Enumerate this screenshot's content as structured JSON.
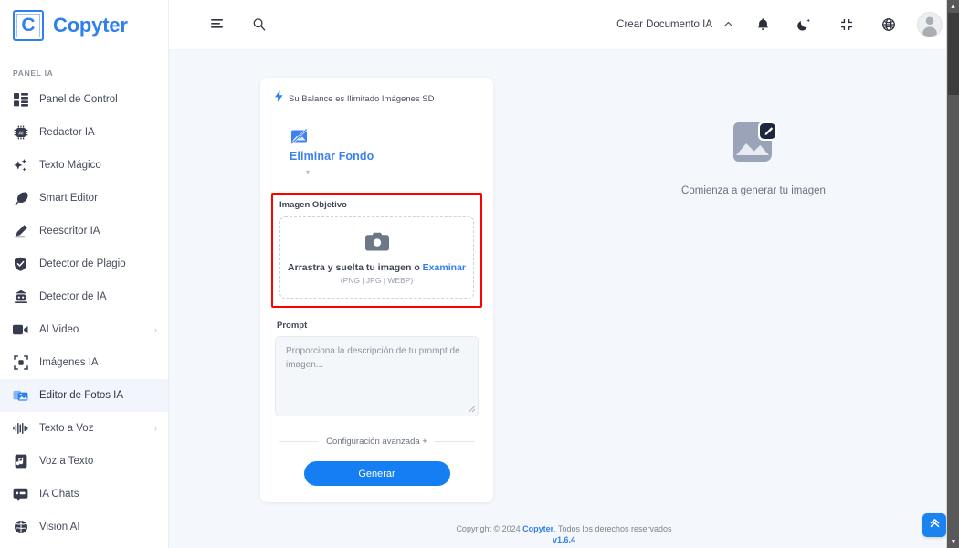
{
  "brand": {
    "mark": "C",
    "name": "Copyter"
  },
  "sidebar": {
    "section_label": "PANEL IA",
    "items": [
      {
        "label": "Panel de Control",
        "icon": "dashboard-icon",
        "active": false,
        "chevron": ""
      },
      {
        "label": "Redactor IA",
        "icon": "chip-ai-icon",
        "active": false,
        "chevron": ""
      },
      {
        "label": "Texto Mágico",
        "icon": "sparkles-icon",
        "active": false,
        "chevron": ""
      },
      {
        "label": "Smart Editor",
        "icon": "feather-icon",
        "active": false,
        "chevron": ""
      },
      {
        "label": "Reescritor IA",
        "icon": "pencil-icon",
        "active": false,
        "chevron": ""
      },
      {
        "label": "Detector de Plagio",
        "icon": "shield-check-icon",
        "active": false,
        "chevron": ""
      },
      {
        "label": "Detector de IA",
        "icon": "robot-icon",
        "active": false,
        "chevron": ""
      },
      {
        "label": "AI Video",
        "icon": "video-camera-icon",
        "active": false,
        "chevron": "›"
      },
      {
        "label": "Imágenes IA",
        "icon": "image-frame-icon",
        "active": false,
        "chevron": ""
      },
      {
        "label": "Editor de Fotos IA",
        "icon": "photo-edit-icon",
        "active": true,
        "chevron": ""
      },
      {
        "label": "Texto a Voz",
        "icon": "waveform-icon",
        "active": false,
        "chevron": "›"
      },
      {
        "label": "Voz a Texto",
        "icon": "audio-file-icon",
        "active": false,
        "chevron": ""
      },
      {
        "label": "IA Chats",
        "icon": "chat-icon",
        "active": false,
        "chevron": ""
      },
      {
        "label": "Vision AI",
        "icon": "brain-icon",
        "active": false,
        "chevron": ""
      }
    ]
  },
  "topbar": {
    "menu_icon": "menu-icon",
    "search_icon": "search-icon",
    "create_document_label": "Crear Documento IA",
    "create_caret": "⌃",
    "notifications_icon": "bell-icon",
    "theme_icon": "moon-icon",
    "fullscreen_icon": "compress-icon",
    "language_icon": "globe-icon",
    "avatar_icon": "user-avatar"
  },
  "card": {
    "balance_icon": "bolt-icon",
    "balance_text": "Su Balance es Ilimitado Imágenes SD",
    "tool": {
      "icon": "remove-background-icon",
      "name": "Eliminar Fondo",
      "caret": "▾"
    },
    "target_image": {
      "label": "Imagen Objetivo",
      "dropzone_icon": "camera-icon",
      "dropzone_text": "Arrastra y suelta tu imagen o",
      "dropzone_link": "Examinar",
      "dropzone_formats": "(PNG | JPG | WEBP)",
      "highlight_color": "#ff0000"
    },
    "prompt": {
      "label": "Prompt",
      "placeholder": "Proporciona la descripción de tu prompt de imagen...",
      "value": ""
    },
    "advanced_label": "Configuración avanzada +",
    "generate_label": "Generar"
  },
  "preview": {
    "icon": "image-edit-placeholder-icon",
    "text": "Comienza a generar tu imagen"
  },
  "footer": {
    "copyright_prefix": "Copyright © 2024 ",
    "brand": "Copyter",
    "copyright_suffix": ". Todos los derechos reservados",
    "version": "v1.6.4"
  },
  "scroll_top": {
    "icon": "chevron-double-up-icon"
  },
  "colors": {
    "accent": "#167ef3",
    "brand_blue": "#2f80ed",
    "page_bg": "#f4f7fb",
    "highlight_red": "#ff0000"
  }
}
